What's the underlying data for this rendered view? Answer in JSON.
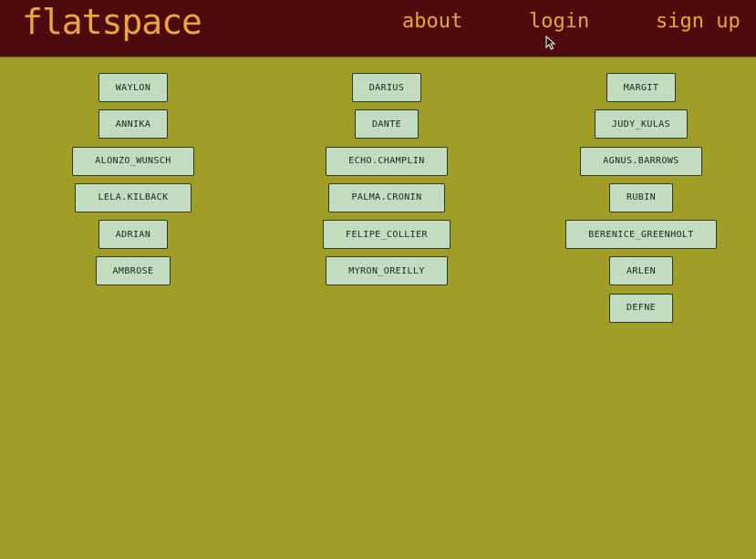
{
  "header": {
    "brand": "flatspace",
    "nav": {
      "about": "about",
      "login": "login",
      "signup": "sign up"
    }
  },
  "columns": [
    {
      "users": [
        "WAYLON",
        "ANNIKA",
        "ALONZO_WUNSCH",
        "LELA.KILBACK",
        "ADRIAN",
        "AMBROSE"
      ]
    },
    {
      "users": [
        "DARIUS",
        "DANTE",
        "ECHO.CHAMPLIN",
        "PALMA.CRONIN",
        "FELIPE_COLLIER",
        "MYRON_OREILLY"
      ]
    },
    {
      "users": [
        "MARGIT",
        "JUDY_KULAS",
        "AGNUS.BARROWS",
        "RUBIN",
        "BERENICE_GREENHOLT",
        "ARLEN",
        "DEFNE"
      ]
    }
  ],
  "colors": {
    "background": "#a09d27",
    "header": "#4e0b0d",
    "accent": "#eaa63b",
    "button": "#c1dcbf"
  },
  "icons": {
    "cursor": "pointer-cursor-icon"
  }
}
